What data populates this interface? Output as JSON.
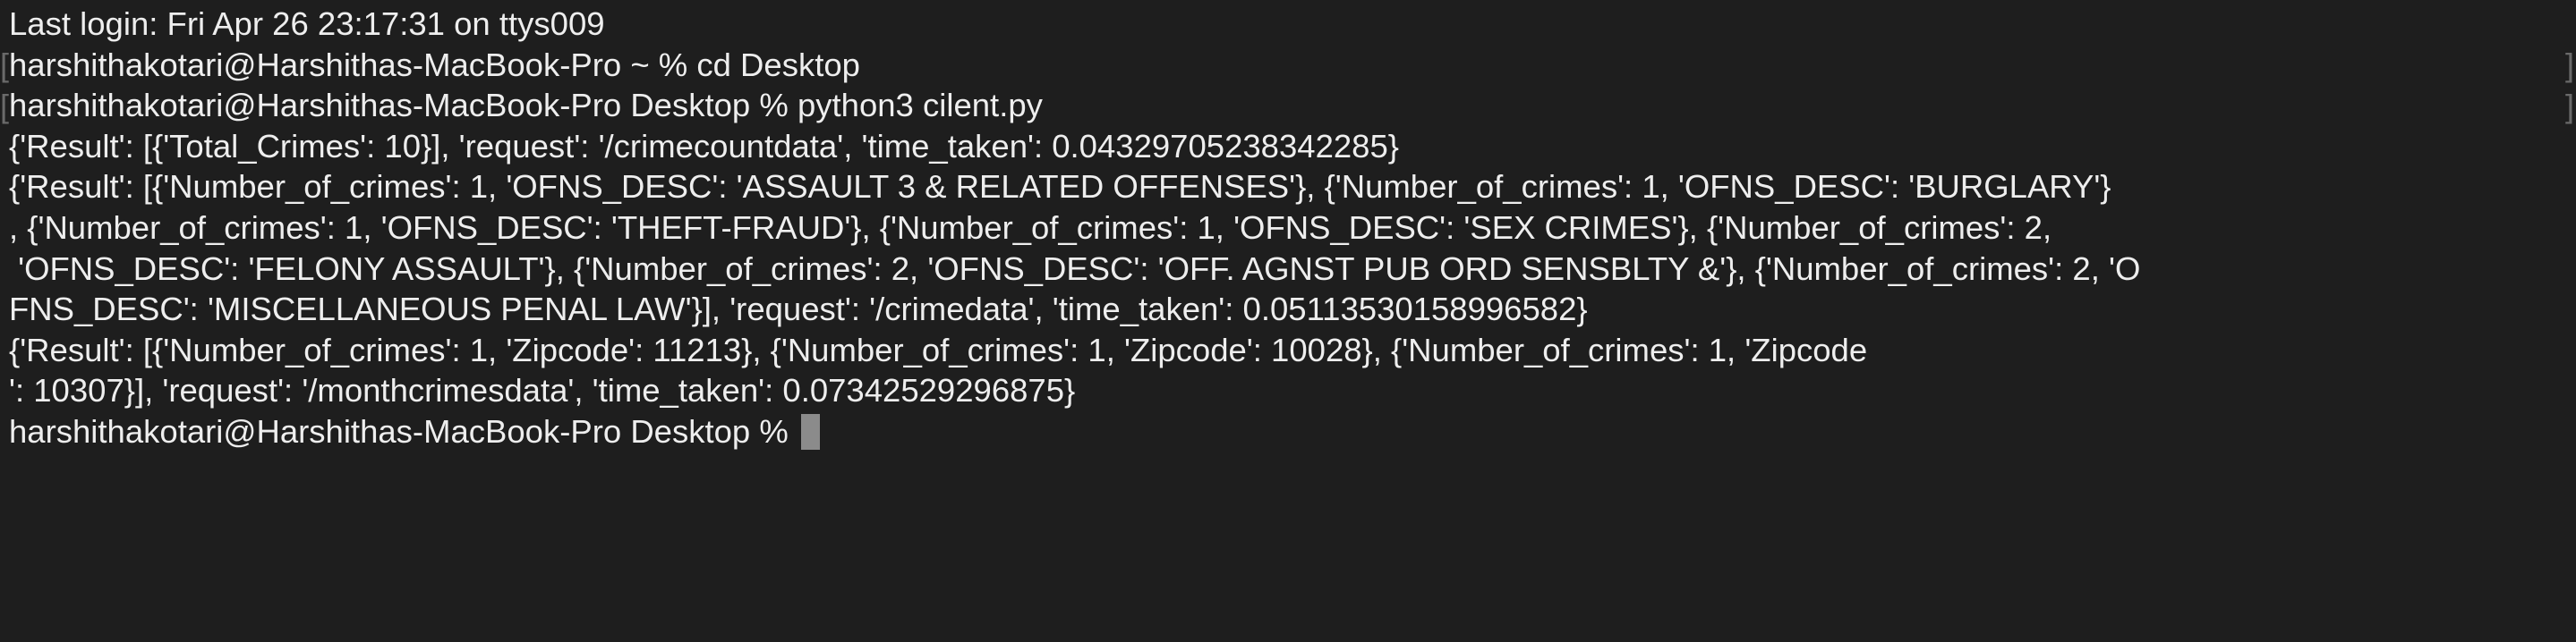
{
  "terminal": {
    "lines": [
      "Last login: Fri Apr 26 23:17:31 on ttys009",
      "harshithakotari@Harshithas-MacBook-Pro ~ % cd Desktop",
      "harshithakotari@Harshithas-MacBook-Pro Desktop % python3 cilent.py",
      "{'Result': [{'Total_Crimes': 10}], 'request': '/crimecountdata', 'time_taken': 0.04329705238342285}",
      "{'Result': [{'Number_of_crimes': 1, 'OFNS_DESC': 'ASSAULT 3 & RELATED OFFENSES'}, {'Number_of_crimes': 1, 'OFNS_DESC': 'BURGLARY'}",
      ", {'Number_of_crimes': 1, 'OFNS_DESC': 'THEFT-FRAUD'}, {'Number_of_crimes': 1, 'OFNS_DESC': 'SEX CRIMES'}, {'Number_of_crimes': 2,",
      " 'OFNS_DESC': 'FELONY ASSAULT'}, {'Number_of_crimes': 2, 'OFNS_DESC': 'OFF. AGNST PUB ORD SENSBLTY &'}, {'Number_of_crimes': 2, 'O",
      "FNS_DESC': 'MISCELLANEOUS PENAL LAW'}], 'request': '/crimedata', 'time_taken': 0.05113530158996582}",
      "{'Result': [{'Number_of_crimes': 1, 'Zipcode': 11213}, {'Number_of_crimes': 1, 'Zipcode': 10028}, {'Number_of_crimes': 1, 'Zipcode",
      "': 10307}], 'request': '/monthcrimesdata', 'time_taken': 0.07342529296875}"
    ],
    "prompt": "harshithakotari@Harshithas-MacBook-Pro Desktop % ",
    "edge_mark": "[",
    "edge_mark_right": "]"
  },
  "colors": {
    "background": "#1e1e1e",
    "text": "#eeeeee",
    "cursor": "#8b8b8b"
  }
}
